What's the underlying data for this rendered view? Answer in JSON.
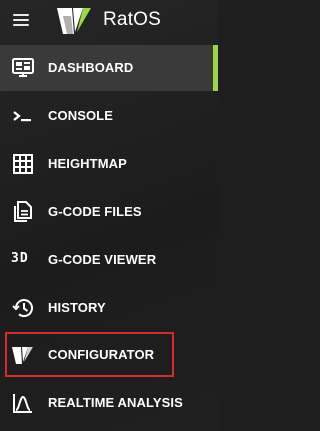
{
  "app": {
    "title": "RatOS"
  },
  "nav": {
    "items": [
      {
        "label": "DASHBOARD",
        "icon": "monitor-dashboard-icon",
        "active": true
      },
      {
        "label": "CONSOLE",
        "icon": "console-icon",
        "active": false
      },
      {
        "label": "HEIGHTMAP",
        "icon": "grid-icon",
        "active": false
      },
      {
        "label": "G-CODE FILES",
        "icon": "file-document-icon",
        "active": false
      },
      {
        "label": "G-CODE VIEWER",
        "icon": "3d-icon",
        "active": false
      },
      {
        "label": "HISTORY",
        "icon": "history-icon",
        "active": false
      },
      {
        "label": "CONFIGURATOR",
        "icon": "ratos-logo-icon",
        "active": false
      },
      {
        "label": "REALTIME ANALYSIS",
        "icon": "chart-bell-curve-icon",
        "active": false
      }
    ],
    "icon_3d_text": "3D"
  },
  "colors": {
    "accent": "#9bd64a",
    "highlight_border": "#d62b2b",
    "active_bg": "#3a3a3a"
  }
}
